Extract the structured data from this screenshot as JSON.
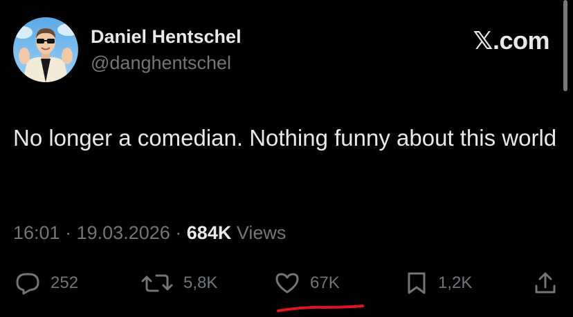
{
  "author": {
    "name": "Daniel Hentschel",
    "handle": "@danghentschel"
  },
  "brand": "𝕏.com",
  "tweet": {
    "text": "No longer a comedian. Nothing funny about this world"
  },
  "meta": {
    "time": "16:01",
    "separator": "·",
    "date": "19.03.2026",
    "views_count": "684K",
    "views_label": "Views"
  },
  "actions": {
    "replies": {
      "icon": "reply-icon",
      "count": "252"
    },
    "reposts": {
      "icon": "repost-icon",
      "count": "5,8K"
    },
    "likes": {
      "icon": "heart-icon",
      "count": "67K"
    },
    "bookmarks": {
      "icon": "bookmark-icon",
      "count": "1,2K"
    },
    "share": {
      "icon": "share-icon"
    }
  },
  "colors": {
    "background": "#000000",
    "primary_text": "#e7e9ea",
    "secondary_text": "#71767b",
    "annotation": "#e0141e"
  }
}
